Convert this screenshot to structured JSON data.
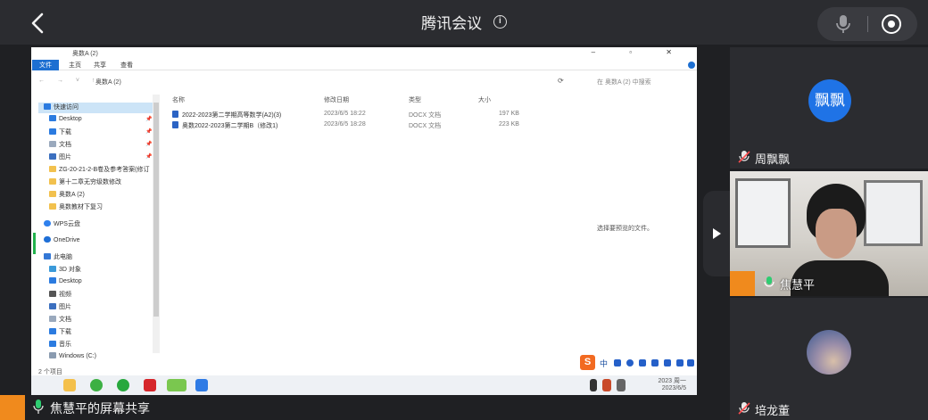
{
  "app_title": "腾讯会议",
  "explorer": {
    "window_path": "奥数A (2)",
    "ribbon_tabs": [
      "文件",
      "主页",
      "共享",
      "查看"
    ],
    "breadcrumb": "奥数A (2)",
    "search_placeholder": "在 奥数A (2) 中搜索",
    "nav_items": [
      "快速访问",
      "Desktop",
      "下载",
      "文档",
      "图片",
      "ZG-20-21-2-B卷及参考答案(修订",
      "第十二章无穷级数修改",
      "奥数A (2)",
      "奥数教材下复习",
      "WPS云盘",
      "OneDrive",
      "此电脑",
      "3D 对象",
      "Desktop",
      "视频",
      "图片",
      "文档",
      "下载",
      "音乐",
      "Windows (C:)"
    ],
    "columns": [
      "名称",
      "修改日期",
      "类型",
      "大小"
    ],
    "files": [
      {
        "name": "2022-2023第二学期高等数学(A2)(3)",
        "date": "2023/6/5 18:22",
        "type": "DOCX 文档",
        "size": "197 KB"
      },
      {
        "name": "奥数2022-2023第二学期B（修改1)",
        "date": "2023/6/5 18:28",
        "type": "DOCX 文档",
        "size": "223 KB"
      }
    ],
    "preview_empty": "选择要预览的文件。",
    "item_count": "2 个项目",
    "clock_time": "2023 周一",
    "clock_date": "2023/6/5"
  },
  "share_label": "焦慧平的屏幕共享",
  "participants": [
    {
      "name": "周飘飘",
      "avatar_text": "飘飘",
      "avatar_color": "#1f73e6"
    },
    {
      "name": "焦慧平"
    },
    {
      "name": "培龙董"
    }
  ],
  "colors": {
    "topbar": "#2b2c30",
    "background": "#1f2023",
    "accent_orange": "#f08a1d",
    "explorer_blue": "#1d6fd1"
  }
}
